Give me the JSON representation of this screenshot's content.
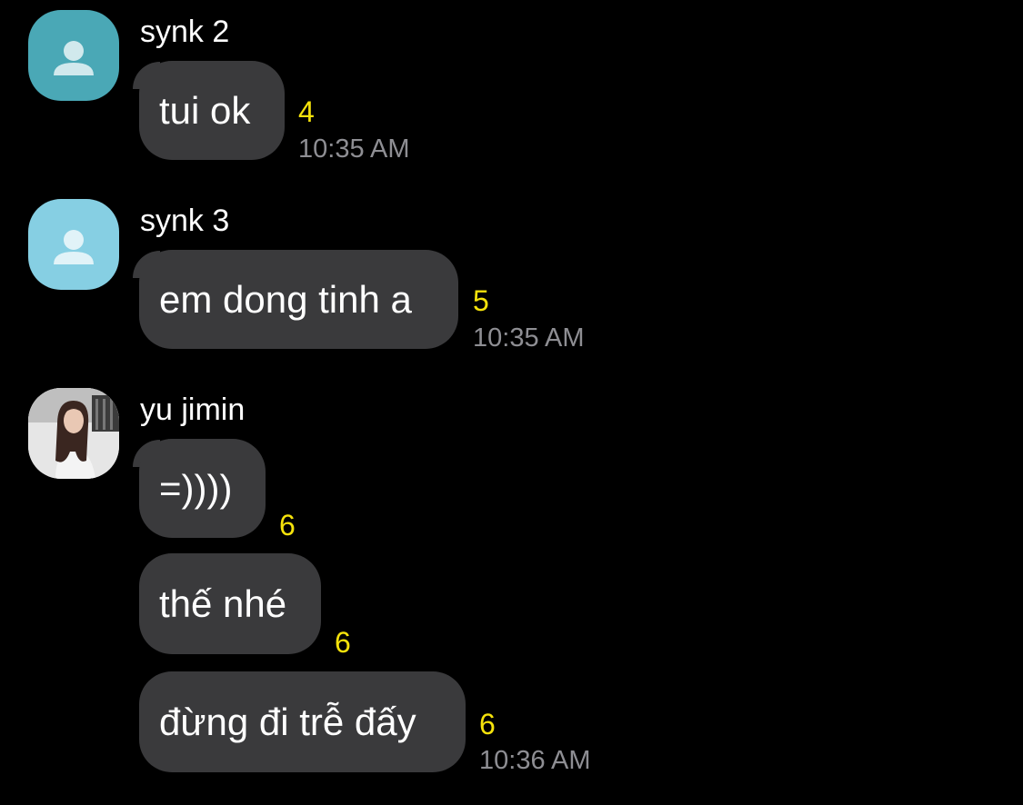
{
  "messages": [
    {
      "sender": "synk 2",
      "avatar_icon": "default-user-icon",
      "bubbles": [
        {
          "text": "tui ok",
          "count": "4"
        }
      ],
      "time": "10:35 AM"
    },
    {
      "sender": "synk 3",
      "avatar_icon": "default-user-icon",
      "bubbles": [
        {
          "text": "em dong tinh a",
          "count": "5"
        }
      ],
      "time": "10:35 AM"
    },
    {
      "sender": "yu jimin",
      "avatar_icon": "profile-photo",
      "bubbles": [
        {
          "text": "=))))",
          "count": "6"
        },
        {
          "text": "thế nhé",
          "count": "6"
        },
        {
          "text": "đừng đi trễ đấy",
          "count": "6"
        }
      ],
      "time": "10:36 AM"
    }
  ],
  "colors": {
    "background": "#000000",
    "bubble": "#3a3a3c",
    "unread_count": "#f5e20b",
    "timestamp": "#8e8e93",
    "avatar_synk2": "#4aa8b6",
    "avatar_synk3": "#86cfe3"
  }
}
